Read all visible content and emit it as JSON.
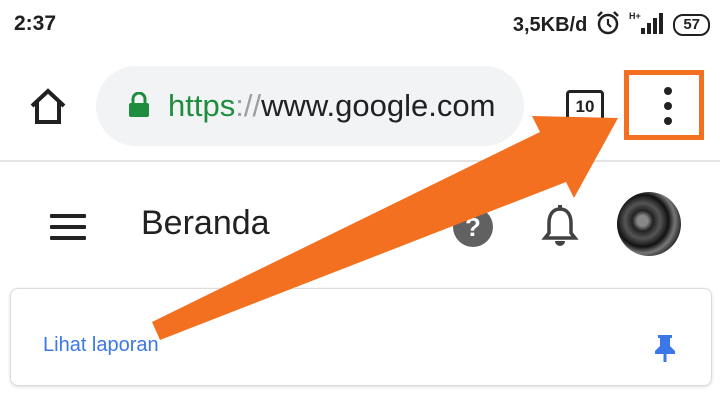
{
  "status_bar": {
    "time": "2:37",
    "net_speed": "3,5KB/d",
    "battery": "57"
  },
  "browser": {
    "url_scheme": "https",
    "url_sep": "://",
    "url_host": "www.google.com",
    "tab_count": "10",
    "accent_color": "#1e8e3e",
    "highlight_color": "#f37021"
  },
  "header": {
    "title": "Beranda"
  },
  "card": {
    "link_text": "Lihat laporan",
    "link_color": "#3b78e7"
  },
  "icons": [
    "home-icon",
    "lock-icon",
    "tab-switcher",
    "more-vert-icon",
    "menu-icon",
    "help-icon",
    "bell-icon",
    "avatar",
    "pin-icon",
    "alarm-icon",
    "signal-icon",
    "arrow-annotation"
  ]
}
